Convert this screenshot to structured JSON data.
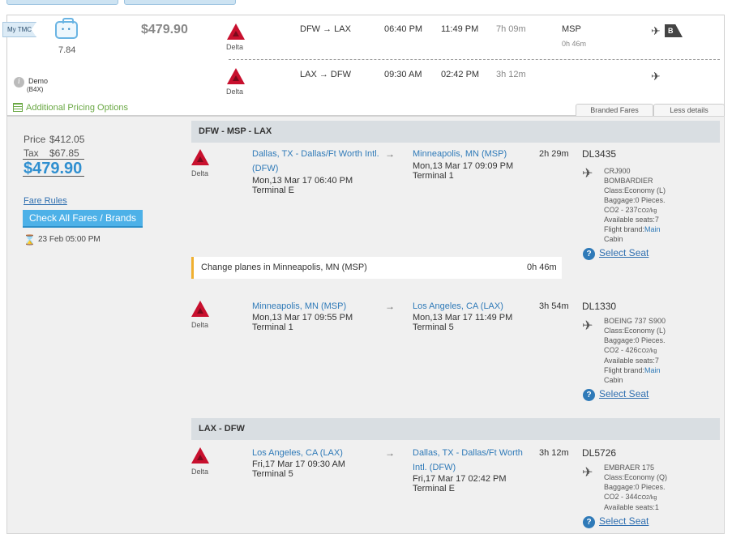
{
  "summary": {
    "mytmc": "My TMC",
    "score": "7.84",
    "price": "$479.90",
    "account_name": "Demo",
    "account_code": "(B4X)",
    "additional_pricing": "Additional Pricing Options",
    "branded_fares": "Branded Fares",
    "less_details": "Less details",
    "legs": [
      {
        "airline": "Delta",
        "route": "DFW → LAX",
        "dep": "06:40 PM",
        "arr": "11:49 PM",
        "duration": "7h 09m",
        "stop": "MSP",
        "stop_time": "0h 46m"
      },
      {
        "airline": "Delta",
        "route": "LAX → DFW",
        "dep": "09:30 AM",
        "arr": "02:42 PM",
        "duration": "3h 12m"
      }
    ]
  },
  "pricing": {
    "price_label": "Price",
    "price_value": "$412.05",
    "tax_label": "Tax",
    "tax_value": "$67.85",
    "total": "$479.90",
    "fare_rules": "Fare Rules",
    "check_fares": "Check All Fares / Brands",
    "deadline": "23 Feb 05:00 PM"
  },
  "trips": [
    {
      "header": "DFW - MSP - LAX"
    },
    {
      "header": "LAX - DFW"
    }
  ],
  "segments": [
    {
      "airline": "Delta",
      "from": "Dallas, TX - Dallas/Ft Worth Intl.",
      "from2": "(DFW)",
      "from_date": "Mon,13 Mar 17 06:40 PM",
      "from_term": "Terminal E",
      "to": "Minneapolis, MN (MSP)",
      "to2": "",
      "to_date": "Mon,13 Mar 17 09:09 PM",
      "to_term": "Terminal 1",
      "duration": "2h 29m",
      "flight": "DL3435",
      "aircraft": "CRJ900",
      "aircraft2": "BOMBARDIER",
      "class": "Class:Economy (L)",
      "baggage": "Baggage:0 Pieces.",
      "co2": "CO2 - 237",
      "co2_unit": "CO2/kg",
      "seats": "Available seats:7",
      "brand_label": "Flight brand:",
      "brand": "Main",
      "brand2": "Cabin",
      "select_seat": "Select Seat"
    },
    {
      "airline": "Delta",
      "from": "Minneapolis, MN (MSP)",
      "from2": "",
      "from_date": "Mon,13 Mar 17 09:55 PM",
      "from_term": "Terminal 1",
      "to": "Los Angeles, CA (LAX)",
      "to2": "",
      "to_date": "Mon,13 Mar 17 11:49 PM",
      "to_term": "Terminal 5",
      "duration": "3h 54m",
      "flight": "DL1330",
      "aircraft": "BOEING 737 S900",
      "aircraft2": "",
      "class": "Class:Economy (L)",
      "baggage": "Baggage:0 Pieces.",
      "co2": "CO2 - 426",
      "co2_unit": "CO2/kg",
      "seats": "Available seats:7",
      "brand_label": "Flight brand:",
      "brand": "Main",
      "brand2": "Cabin",
      "select_seat": "Select Seat"
    },
    {
      "airline": "Delta",
      "from": "Los Angeles, CA (LAX)",
      "from2": "",
      "from_date": "Fri,17 Mar 17 09:30 AM",
      "from_term": "Terminal 5",
      "to": "Dallas, TX - Dallas/Ft Worth",
      "to2": "Intl. (DFW)",
      "to_date": "Fri,17 Mar 17 02:42 PM",
      "to_term": "Terminal E",
      "duration": "3h 12m",
      "flight": "DL5726",
      "aircraft": "EMBRAER 175",
      "aircraft2": "",
      "class": "Class:Economy (Q)",
      "baggage": "Baggage:0 Pieces.",
      "co2": "CO2 - 344",
      "co2_unit": "CO2/kg",
      "seats": "Available seats:1",
      "brand_label": "",
      "brand": "",
      "brand2": "",
      "select_seat": "Select Seat"
    }
  ],
  "connection": {
    "text": "Change planes in Minneapolis, MN (MSP)",
    "duration": "0h 46m"
  },
  "icons": {
    "accent": "#4db1e8",
    "delta_red": "#c8102e"
  }
}
